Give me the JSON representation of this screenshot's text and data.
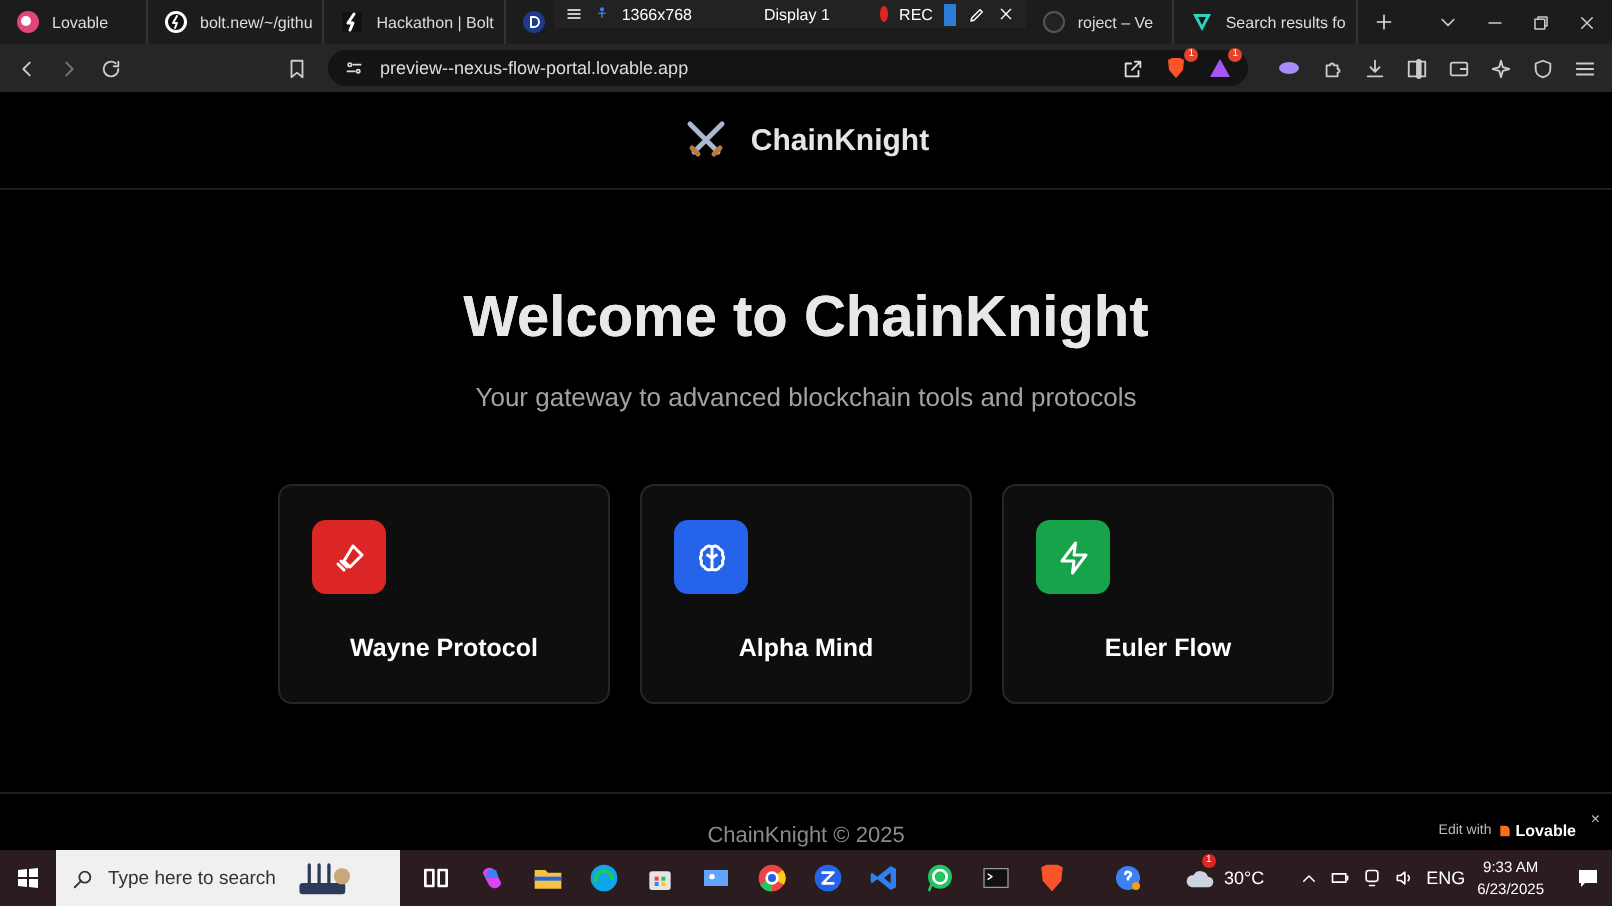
{
  "browser": {
    "tabs": [
      {
        "title": "Lovable",
        "kind": "lovable"
      },
      {
        "title": "bolt.new/~/githu",
        "kind": "bolt"
      },
      {
        "title": "Hackathon | Bolt",
        "kind": "bolt-square"
      },
      {
        "title": "roject – Ve",
        "kind": "dark"
      },
      {
        "title": "Search results fo",
        "kind": "vee"
      }
    ],
    "recorder": {
      "resolution": "1366x768",
      "display": "Display 1",
      "rec": "REC"
    },
    "url": "preview--nexus-flow-portal.lovable.app",
    "shield_badge": "1",
    "rewards_badge": "1"
  },
  "page": {
    "brand": "ChainKnight",
    "title": "Welcome to ChainKnight",
    "subtitle": "Your gateway to advanced blockchain tools and protocols",
    "cards": [
      {
        "title": "Wayne Protocol",
        "kind": "sword",
        "color": "#dc2626"
      },
      {
        "title": "Alpha Mind",
        "kind": "brain",
        "color": "#2563eb"
      },
      {
        "title": "Euler Flow",
        "kind": "bolt",
        "color": "#16a34a"
      }
    ],
    "footer": "ChainKnight © 2025",
    "edit_badge": {
      "prefix": "Edit with",
      "brand": "Lovable",
      "close": "×"
    }
  },
  "taskbar": {
    "search_placeholder": "Type here to search",
    "weather_badge": "1",
    "temperature": "30°C",
    "language": "ENG",
    "time": "9:33 AM",
    "date": "6/23/2025"
  }
}
